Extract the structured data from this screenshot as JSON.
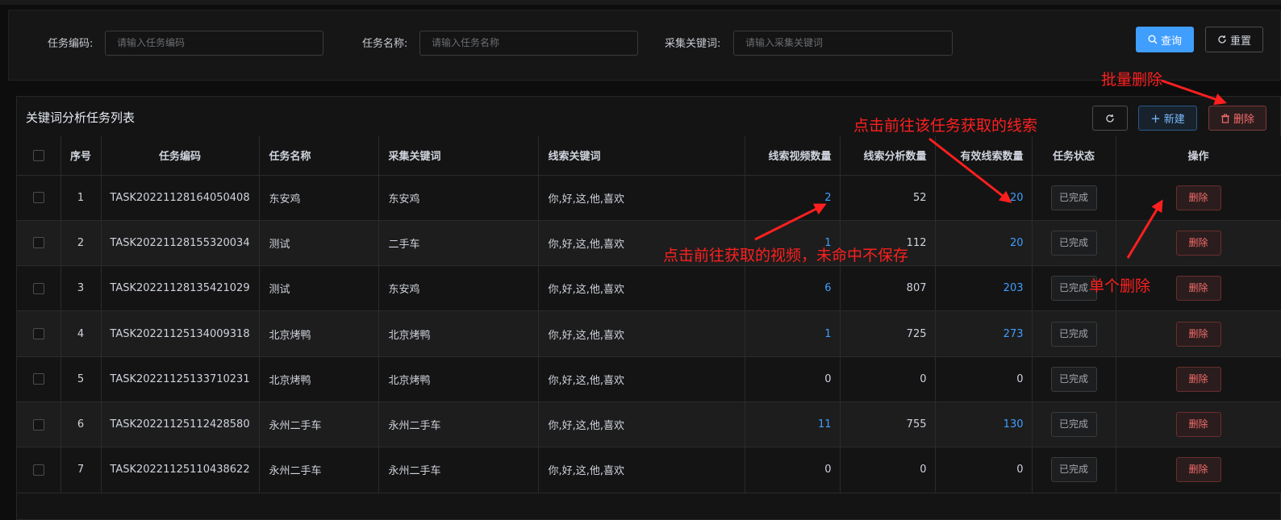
{
  "search": {
    "task_code_label": "任务编码:",
    "task_code_placeholder": "请输入任务编码",
    "task_name_label": "任务名称:",
    "task_name_placeholder": "请输入任务名称",
    "keyword_label": "采集关键词:",
    "keyword_placeholder": "请输入采集关键词",
    "query_label": "查询",
    "reset_label": "重置"
  },
  "table_section": {
    "title": "关键词分析任务列表",
    "new_label": "新建",
    "batch_delete_label": "删除"
  },
  "columns": [
    "序号",
    "任务编码",
    "任务名称",
    "采集关键词",
    "线索关键词",
    "线索视频数量",
    "线索分析数量",
    "有效线索数量",
    "任务状态",
    "操作"
  ],
  "rows": [
    {
      "idx": "1",
      "code": "TASK20221128164050408",
      "name": "东安鸡",
      "keyword": "东安鸡",
      "clue_kw": "你,好,这,他,喜欢",
      "videos": "2",
      "analysis": "52",
      "valid": "20",
      "status": "已完成",
      "op": "删除"
    },
    {
      "idx": "2",
      "code": "TASK20221128155320034",
      "name": "测试",
      "keyword": "二手车",
      "clue_kw": "你,好,这,他,喜欢",
      "videos": "1",
      "analysis": "112",
      "valid": "20",
      "status": "已完成",
      "op": "删除"
    },
    {
      "idx": "3",
      "code": "TASK20221128135421029",
      "name": "测试",
      "keyword": "东安鸡",
      "clue_kw": "你,好,这,他,喜欢",
      "videos": "6",
      "analysis": "807",
      "valid": "203",
      "status": "已完成",
      "op": "删除"
    },
    {
      "idx": "4",
      "code": "TASK20221125134009318",
      "name": "北京烤鸭",
      "keyword": "北京烤鸭",
      "clue_kw": "你,好,这,他,喜欢",
      "videos": "1",
      "analysis": "725",
      "valid": "273",
      "status": "已完成",
      "op": "删除"
    },
    {
      "idx": "5",
      "code": "TASK20221125133710231",
      "name": "北京烤鸭",
      "keyword": "北京烤鸭",
      "clue_kw": "你,好,这,他,喜欢",
      "videos": "0",
      "analysis": "0",
      "valid": "0",
      "status": "已完成",
      "op": "删除"
    },
    {
      "idx": "6",
      "code": "TASK20221125112428580",
      "name": "永州二手车",
      "keyword": "永州二手车",
      "clue_kw": "你,好,这,他,喜欢",
      "videos": "11",
      "analysis": "755",
      "valid": "130",
      "status": "已完成",
      "op": "删除"
    },
    {
      "idx": "7",
      "code": "TASK20221125110438622",
      "name": "永州二手车",
      "keyword": "永州二手车",
      "clue_kw": "你,好,这,他,喜欢",
      "videos": "0",
      "analysis": "0",
      "valid": "0",
      "status": "已完成",
      "op": "删除"
    }
  ],
  "annotations": {
    "batch_delete": "批量删除",
    "clue_link": "点击前往该任务获取的线索",
    "video_link": "点击前往获取的视频，未命中不保存",
    "single_delete": "单个删除"
  },
  "colors": {
    "primary": "#409eff",
    "danger": "#f56c6c",
    "annotation": "#ff1f1f"
  }
}
